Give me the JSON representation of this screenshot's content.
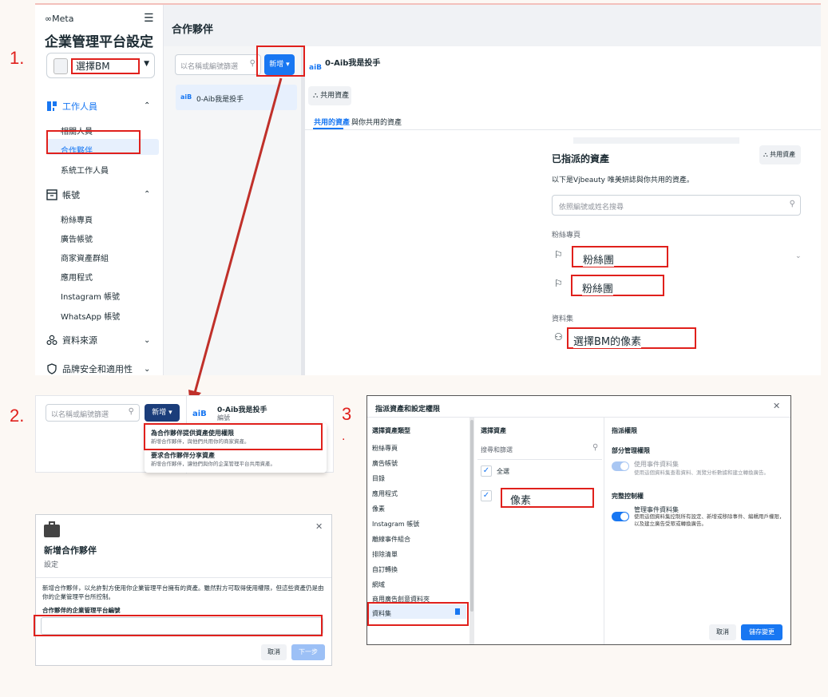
{
  "steps": {
    "s1": "1.",
    "s2": "2.",
    "s3": "3",
    "s3_dot": "."
  },
  "colors": {
    "annotation_red": "#e0201c",
    "accent": "#1877f2"
  },
  "panel1": {
    "brand": "∞Meta",
    "page_title": "企業管理平台設定",
    "bm_select_label": "選擇BM",
    "sections": {
      "users": {
        "label": "工作人員",
        "items": [
          "相關人員",
          "合作夥伴",
          "系統工作人員"
        ]
      },
      "accounts": {
        "label": "帳號",
        "items": [
          "粉絲專頁",
          "廣告帳號",
          "商家資產群組",
          "應用程式",
          "Instagram 帳號",
          "WhatsApp 帳號"
        ]
      },
      "data_sources": {
        "label": "資料來源"
      },
      "brand_safety": {
        "label": "品牌安全和適用性"
      }
    },
    "main_title": "合作夥伴",
    "search_placeholder": "以名稱或編號篩選",
    "new_button": "新增 ▾",
    "partner_name": "0-Aib我是投手",
    "partner_logo": "aiB",
    "share_assets": "共用資產",
    "tabs": [
      "共用的資產",
      "與你共用的資產"
    ],
    "assigned_title": "已指派的資產",
    "assigned_subtitle": "以下是Vjbeauty 唯美妍誌與你共用的資產。",
    "assigned_search": "依照編號或姓名搜尋",
    "fan_pages_label": "粉絲專頁",
    "fan_page_1": "粉絲團",
    "fan_page_2": "粉絲團",
    "datasets_label": "資料集",
    "dataset_item": "選擇BM的像素"
  },
  "panel2": {
    "search_placeholder": "以名稱或編號篩選",
    "new_button": "新增 ▾",
    "partner_logo": "aiB",
    "partner_name": "0-Aib我是投手",
    "partner_sub": "編號",
    "menu": [
      {
        "title": "為合作夥伴提供資產使用權限",
        "sub": "新增合作夥伴，與他們共用你的商家資產。"
      },
      {
        "title": "要求合作夥伴分享資產",
        "sub": "新增合作夥伴，讓他們與你的企業管理平台共用資產。"
      }
    ]
  },
  "panel2b": {
    "title": "新增合作夥伴",
    "subtitle": "設定",
    "body": "新增合作夥伴，以允許對方使用你企業管理平台擁有的資產。雖然對方可取得使用權限，但這些資產仍是由你的企業管理平台所控制。",
    "field_label": "合作夥伴的企業管理平台編號",
    "cancel": "取消",
    "next": "下一步"
  },
  "panel3": {
    "title": "指派資產和設定權限",
    "col1_head": "選擇資產類型",
    "types": [
      "粉絲專頁",
      "廣告帳號",
      "目錄",
      "應用程式",
      "像素",
      "Instagram 帳號",
      "離線事件組合",
      "排除清單",
      "自訂轉換",
      "網域",
      "商用廣告創意資料夾",
      "資料集"
    ],
    "col2_head": "選擇資產",
    "search_placeholder": "搜尋和篩選",
    "select_all": "全選",
    "pixel_item": "像素",
    "col3_head": "指派權限",
    "partial_head": "部分管理權限",
    "partial_title": "使用事件資料集",
    "partial_desc": "使用這個資料集查看資料、測覽分析數據和建立轉換廣告。",
    "full_head": "完整控制權",
    "full_title": "管理事件資料集",
    "full_desc": "使用這個資料集控制所有設定、新增或移除事件、編輯用戶權限，以及建立廣告受眾或轉換廣告。",
    "cancel": "取消",
    "save": "儲存變更"
  }
}
